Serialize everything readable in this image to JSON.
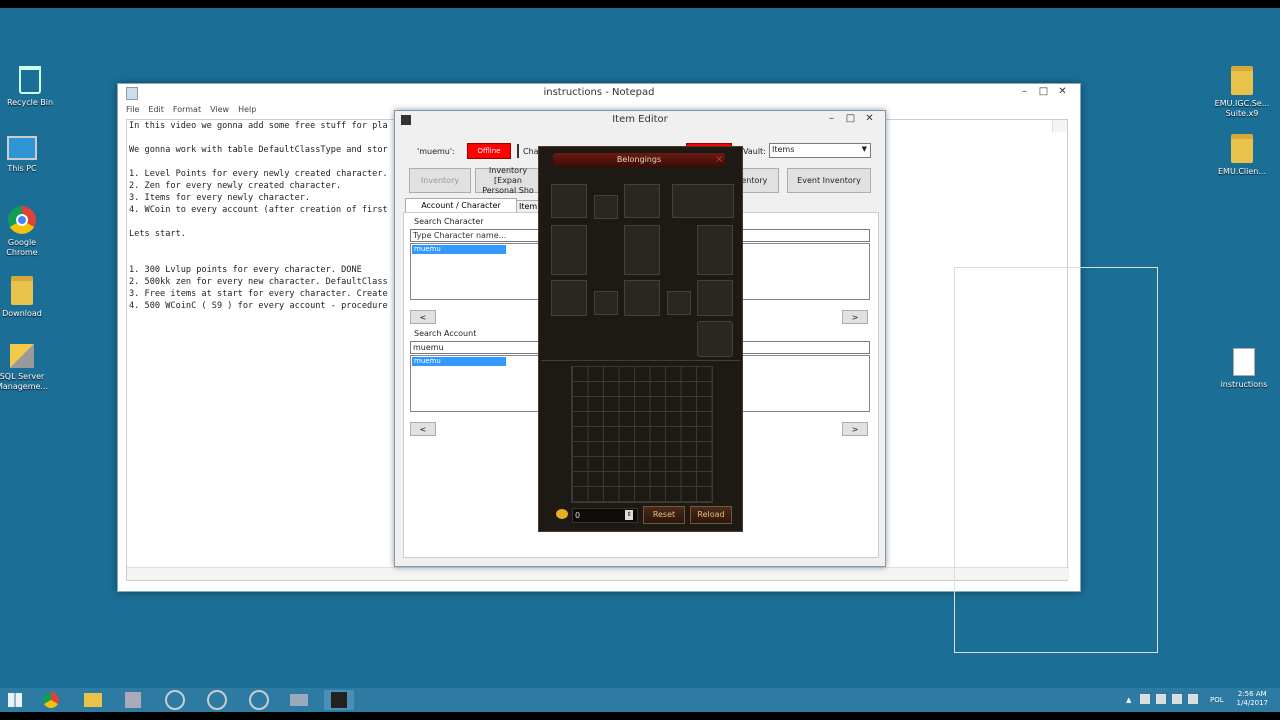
{
  "desktop": {
    "icons_left": [
      {
        "label": "Recycle Bin",
        "icon": "recycle-bin-icon"
      },
      {
        "label": "This PC",
        "icon": "computer-icon"
      },
      {
        "label": "Google Chrome",
        "icon": "chrome-icon"
      },
      {
        "label": "Download",
        "icon": "folder-icon"
      },
      {
        "label": "SQL Server Manageme...",
        "icon": "sql-server-icon"
      }
    ],
    "icons_right": [
      {
        "label": "EMU.IGC.Se... Suite.x9",
        "icon": "folder-icon"
      },
      {
        "label": "EMU.Clien...",
        "icon": "folder-icon"
      },
      {
        "label": "instructions",
        "icon": "text-document-icon"
      }
    ]
  },
  "notepad": {
    "title": "instructions - Notepad",
    "menu": [
      "File",
      "Edit",
      "Format",
      "View",
      "Help"
    ],
    "lines": [
      "In this video we gonna add some free stuff for pla",
      "",
      "We gonna work with table DefaultClassType and stor",
      "",
      "1. Level Points for every newly created character.",
      "2. Zen for every newly created character.",
      "3. Items for every newly character.",
      "4. WCoin to every account (after creation of first",
      "",
      "Lets start.",
      "",
      "",
      "1. 300 Lvlup points for every character. DONE",
      "2. 500kk zen for every new character. DefaultClass",
      "3. Free items at start for every character. Create",
      "4. 500 WCoinC ( S9 ) for every account - procedure"
    ]
  },
  "item_editor": {
    "title": "Item Editor",
    "char_name": "'muemu':",
    "char_status": "Offline",
    "char_label": "Cha",
    "vault_label": "Vault:",
    "vault_value": "Items",
    "buttons": {
      "inventory": "Inventory",
      "inventory_expanded": "Inventory [Expan Personal Sho",
      "ventory": "ventory",
      "event_inventory": "Event Inventory"
    },
    "tabs": [
      "Account / Character Selector",
      "Item S"
    ],
    "search_character_label": "Search Character",
    "search_character_placeholder": "Type Character name...",
    "character_selected": "muemu",
    "search_account_label": "Search Account",
    "search_account_value": "muemu",
    "account_selected": "muemu",
    "prev": "<",
    "next": ">"
  },
  "belongings": {
    "title": "Belongings",
    "close": "×",
    "zen_value": "0",
    "reset_label": "Reset",
    "reload_label": "Reload"
  },
  "taskbar": {
    "lang": "POL",
    "time": "2:56 AM",
    "date": "1/4/2017",
    "apps": [
      "start-icon",
      "chrome-icon",
      "file-explorer-icon",
      "tool-icon",
      "cs-icon",
      "ds-icon",
      "gs-icon",
      "editor-icon",
      "game-icon"
    ]
  }
}
